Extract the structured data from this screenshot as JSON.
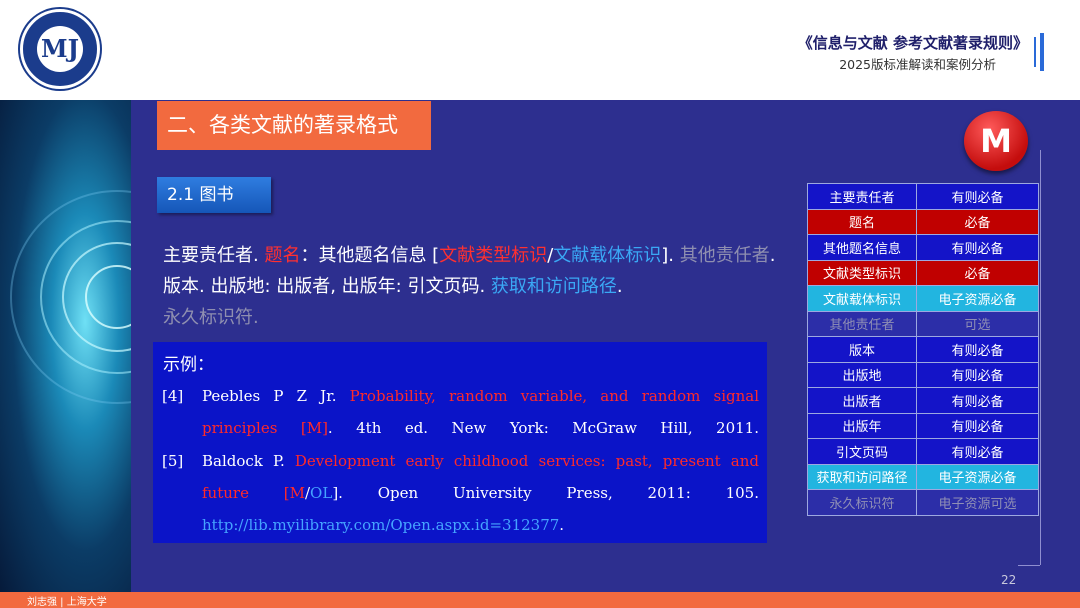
{
  "header": {
    "logo_text": "MJ",
    "title": "《信息与文献  参考文献著录规则》",
    "subtitle": "2025版标准解读和案例分析"
  },
  "colors": {
    "accent_orange": "#f26a3f",
    "background": "#2d2f8f",
    "required": "#1414c8",
    "mandatory": "#c00000",
    "electronic": "#22b5e0"
  },
  "section": {
    "title": "二、各类文献的著录格式",
    "subtitle": "2.1  图书"
  },
  "format": {
    "author": "主要责任者",
    "sep1": ". ",
    "title": "题名",
    "sep2": "：其他题名信息 [",
    "type_id": "文献类型标识",
    "slash": "/",
    "carrier_id": "文献载体标识",
    "sep3": "]. ",
    "other_resp": "其他责任者",
    "rest": ". 版本. 出版地: 出版者, 出版年: 引文页码.  ",
    "access": "获取和访问路径",
    "dot": ".",
    "doi": "永久标识符",
    "end": "."
  },
  "example": {
    "label": "示例：",
    "refs": [
      {
        "num": "[4]",
        "author": "Peebles P Z Jr. ",
        "title": "Probability, random variable, and random signal principles [M]",
        "rest": ". 4th ed. New York: McGraw Hill, 2011."
      },
      {
        "num": "[5]",
        "author": "Baldock P. ",
        "title": "Development early childhood services: past, present and future",
        "bracket_open": " [M",
        "slash": "/",
        "ol": "OL",
        "rest": "]. Open University Press, 2011: 105.",
        "url": "http://lib.myilibrary.com/Open.aspx.id=312377",
        "end": "."
      }
    ]
  },
  "badge": {
    "label": "M"
  },
  "table": {
    "rows": [
      {
        "element": "主要责任者",
        "status": "有则必备",
        "kind": "required"
      },
      {
        "element": "题名",
        "status": "必备",
        "kind": "mandatory"
      },
      {
        "element": "其他题名信息",
        "status": "有则必备",
        "kind": "required"
      },
      {
        "element": "文献类型标识",
        "status": "必备",
        "kind": "mandatory"
      },
      {
        "element": "文献载体标识",
        "status": "电子资源必备",
        "kind": "electronic"
      },
      {
        "element": "其他责任者",
        "status": "可选",
        "kind": "optional"
      },
      {
        "element": "版本",
        "status": "有则必备",
        "kind": "required"
      },
      {
        "element": "出版地",
        "status": "有则必备",
        "kind": "required"
      },
      {
        "element": "出版者",
        "status": "有则必备",
        "kind": "required"
      },
      {
        "element": "出版年",
        "status": "有则必备",
        "kind": "required"
      },
      {
        "element": "引文页码",
        "status": "有则必备",
        "kind": "required"
      },
      {
        "element": "获取和访问路径",
        "status": "电子资源必备",
        "kind": "electronic"
      },
      {
        "element": "永久标识符",
        "status": "电子资源可选",
        "kind": "optional"
      }
    ]
  },
  "footer": {
    "text": "刘志强 | 上海大学",
    "page": "22"
  }
}
